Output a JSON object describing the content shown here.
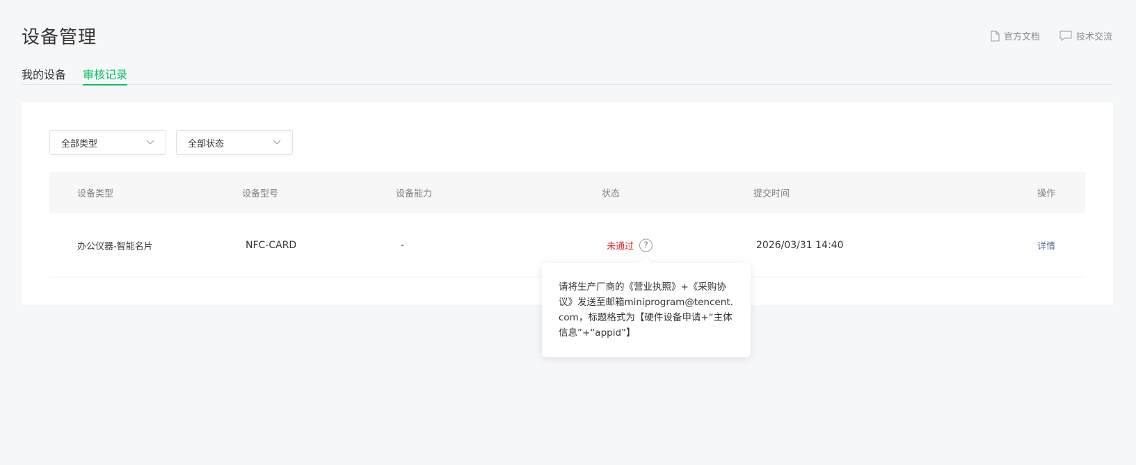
{
  "header": {
    "title": "设备管理",
    "links": [
      {
        "label": "官方文档",
        "icon": "document-icon"
      },
      {
        "label": "技术交流",
        "icon": "chat-icon"
      }
    ]
  },
  "tabs": [
    {
      "label": "我的设备",
      "active": false
    },
    {
      "label": "审核记录",
      "active": true
    }
  ],
  "filters": {
    "type_select": "全部类型",
    "status_select": "全部状态"
  },
  "table": {
    "headers": [
      "设备类型",
      "设备型号",
      "设备能力",
      "状态",
      "提交时间",
      "操作"
    ],
    "rows": [
      {
        "type": "办公仪器-智能名片",
        "model": "NFC-CARD",
        "capability": "-",
        "status": "未通过",
        "submitted": "2026/03/31 14:40",
        "action": "详情"
      }
    ]
  },
  "tooltip": {
    "text": "请将生产厂商的《营业执照》+《采购协议》发送至邮箱miniprogram@tencent.com，标题格式为【硬件设备申请+“主体信息”+“appid”】"
  },
  "colors": {
    "accent": "#07c160",
    "error": "#e0242a",
    "link": "#576b95"
  }
}
